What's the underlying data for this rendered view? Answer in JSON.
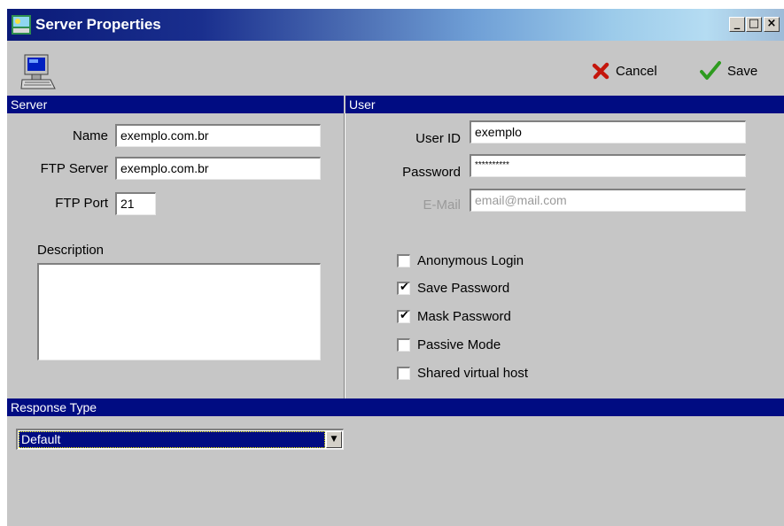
{
  "window": {
    "title": "Server Properties"
  },
  "titlebar_buttons": {
    "minimize": "_",
    "maximize": "□",
    "close": "×"
  },
  "toolbar": {
    "cancel_label": "Cancel",
    "save_label": "Save"
  },
  "server": {
    "header": "Server",
    "name_label": "Name",
    "name_value": "exemplo.com.br",
    "ftp_server_label": "FTP Server",
    "ftp_server_value": "exemplo.com.br",
    "ftp_port_label": "FTP Port",
    "ftp_port_value": "21",
    "description_label": "Description",
    "description_value": ""
  },
  "user": {
    "header": "User",
    "user_id_label": "User ID",
    "user_id_value": "exemplo",
    "password_label": "Password",
    "password_value": "**********",
    "email_label": "E-Mail",
    "email_value": "email@mail.com",
    "options": [
      {
        "label": "Anonymous Login",
        "checked": false
      },
      {
        "label": "Save Password",
        "checked": true
      },
      {
        "label": "Mask Password",
        "checked": true
      },
      {
        "label": "Passive Mode",
        "checked": false
      },
      {
        "label": "Shared virtual host",
        "checked": false
      }
    ]
  },
  "response": {
    "header": "Response Type",
    "selected": "Default"
  },
  "colors": {
    "section_header": "#000c82",
    "cancel": "#c4160c",
    "save": "#2e9b1f"
  },
  "icons": {
    "app": "server-app-icon",
    "server": "computer-icon",
    "cancel": "x-icon",
    "save": "checkmark-icon"
  }
}
